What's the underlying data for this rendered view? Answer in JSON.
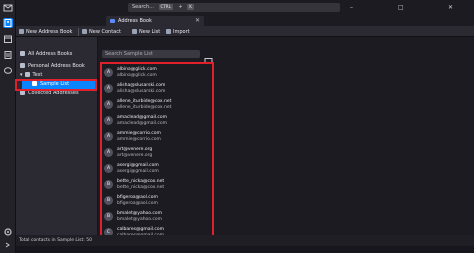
{
  "titlebar": {
    "search_placeholder": "Search...",
    "shortcut_ctrl": "CTRL",
    "shortcut_key": "K",
    "minimize": "–",
    "maximize": "□",
    "close": "✕"
  },
  "tab": {
    "label": "Address Book",
    "close": "✕"
  },
  "toolbar": {
    "new_address_book": "New Address Book",
    "new_contact": "New Contact",
    "new_list": "New List",
    "import": "Import"
  },
  "tree": {
    "all_address_books": "All Address Books",
    "personal_address_book": "Personal Address Book",
    "test": "Test",
    "sample_list": "Sample List",
    "collected_addresses": "Collected Addresses"
  },
  "list_search_placeholder": "Search Sample List",
  "contacts": [
    {
      "initial": "A",
      "name": "albina@glick.com",
      "email": "albina@glick.com"
    },
    {
      "initial": "A",
      "name": "alisha@slusarski.com",
      "email": "alisha@slusarski.com"
    },
    {
      "initial": "A",
      "name": "allene_iturbide@cox.net",
      "email": "allene_iturbide@cox.net"
    },
    {
      "initial": "A",
      "name": "amaclead@gmail.com",
      "email": "amaclead@gmail.com"
    },
    {
      "initial": "A",
      "name": "ammie@corrio.com",
      "email": "ammie@corrio.com"
    },
    {
      "initial": "A",
      "name": "art@venere.org",
      "email": "art@venere.org"
    },
    {
      "initial": "A",
      "name": "asergi@gmail.com",
      "email": "asergi@gmail.com"
    },
    {
      "initial": "B",
      "name": "bette_nicka@cox.net",
      "email": "bette_nicka@cox.net"
    },
    {
      "initial": "B",
      "name": "bfigeroa@aol.com",
      "email": "bfigeroa@aol.com"
    },
    {
      "initial": "B",
      "name": "bmalet@yahoo.com",
      "email": "bmalet@yahoo.com"
    },
    {
      "initial": "C",
      "name": "calbares@gmail.com",
      "email": "calbares@gmail.com"
    }
  ],
  "footer": "Total contacts in Sample List: 50",
  "colors": {
    "accent": "#0a84ff",
    "highlight": "#e0202a"
  }
}
